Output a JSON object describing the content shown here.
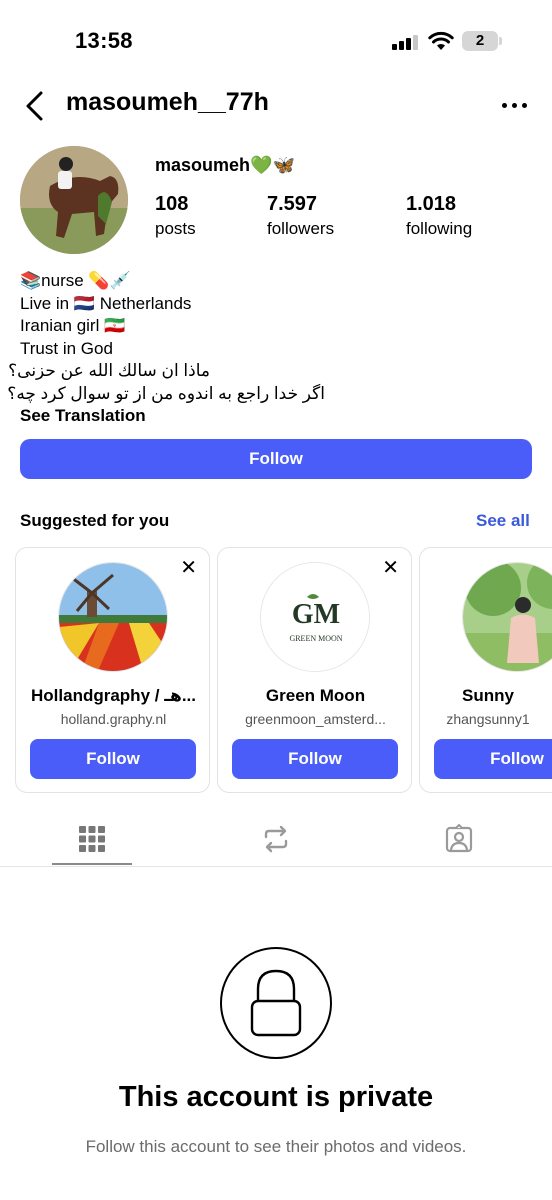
{
  "status_bar": {
    "time": "13:58",
    "battery": "2"
  },
  "header": {
    "username": "masoumeh__77h"
  },
  "profile": {
    "display_name": "masoumeh💚🦋",
    "stats": [
      {
        "value": "108",
        "label": "posts"
      },
      {
        "value": "7.597",
        "label": "followers"
      },
      {
        "value": "1.018",
        "label": "following"
      }
    ],
    "bio_lines": [
      "📚nurse 💊💉",
      "Live in 🇳🇱 Netherlands",
      "Iranian girl 🇮🇷",
      "Trust in God",
      "ماذا ان سالك الله عن حزنى؟",
      "اگر خدا راجع به اندوه من از تو سوال کرد چه؟"
    ],
    "see_translation": "See Translation",
    "follow_label": "Follow"
  },
  "suggested": {
    "title": "Suggested for you",
    "see_all": "See all",
    "cards": [
      {
        "name": "Hollandgraphy / هـ...",
        "handle": "holland.graphy.nl",
        "follow": "Follow"
      },
      {
        "name": "Green Moon",
        "handle": "greenmoon_amsterd...",
        "follow": "Follow",
        "logo_text": "GREEN MOON"
      },
      {
        "name": "Sunny",
        "handle": "zhangsunny1",
        "follow": "Follow"
      }
    ]
  },
  "private": {
    "title": "This account is private",
    "subtitle": "Follow this account to see their photos and videos."
  },
  "colors": {
    "accent": "#4a5df9",
    "link": "#3a5bd9"
  }
}
